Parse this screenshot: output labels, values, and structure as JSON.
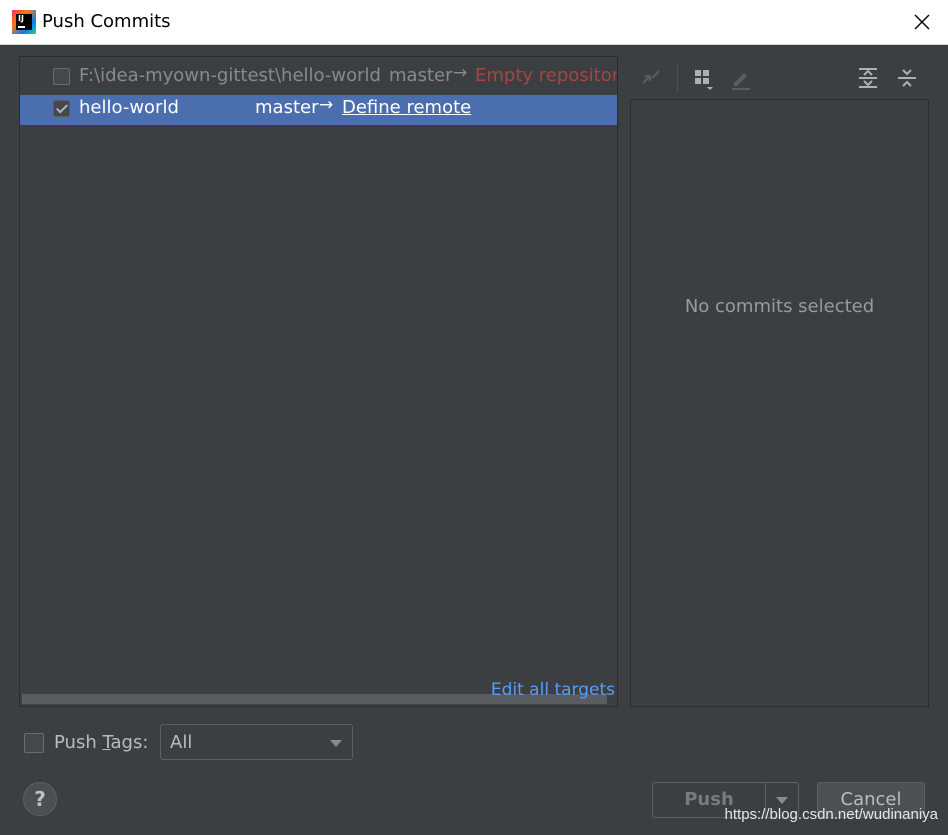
{
  "window": {
    "title": "Push Commits",
    "app_icon_text": "IJ"
  },
  "repositories": [
    {
      "checked": false,
      "path": "F:\\idea-myown-gittest\\hello-world",
      "branch": "master",
      "arrow": "→",
      "target": "Empty repository",
      "target_style": "error",
      "selected": false
    },
    {
      "checked": true,
      "path": "hello-world",
      "branch": "master",
      "arrow": "→",
      "target": "Define remote",
      "target_style": "link",
      "selected": true
    }
  ],
  "edit_all_targets": "Edit all targets",
  "toolbar": {
    "icons": [
      "expand-arrows-icon",
      "group-by-icon",
      "edit-icon",
      "expand-all-icon",
      "collapse-all-icon"
    ]
  },
  "details": {
    "empty_text": "No commits selected"
  },
  "push_tags": {
    "label_before": "Push ",
    "label_mnemonic": "T",
    "label_after": "ags:",
    "checked": false,
    "selected_option": "All"
  },
  "buttons": {
    "help": "?",
    "push": "Push",
    "cancel": "Cancel"
  },
  "watermark": "https://blog.csdn.net/wudinaniya",
  "colors": {
    "background": "#3c3f41",
    "selection": "#4b6eaf",
    "error_text": "#a54444",
    "link_text": "#589df6"
  }
}
